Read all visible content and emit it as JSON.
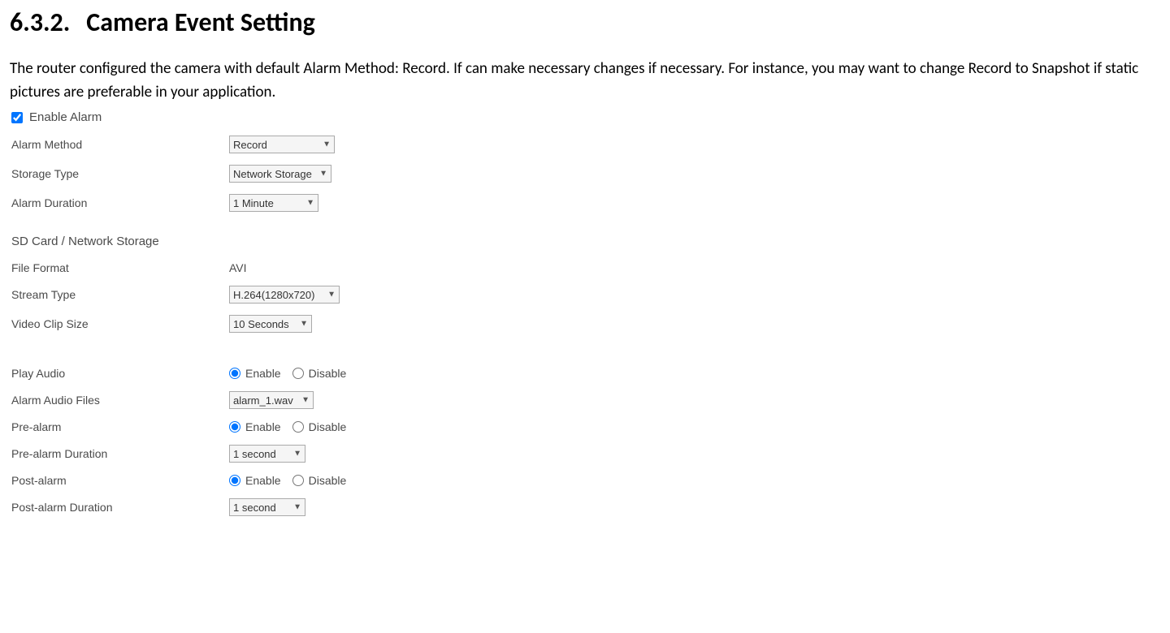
{
  "heading": {
    "number": "6.3.2.",
    "title": "Camera Event Setting"
  },
  "intro": "The router configured the camera with default Alarm Method: Record. If can make necessary changes if necessary. For instance, you may want to change Record to Snapshot if static pictures are preferable in your application.",
  "enable_alarm": {
    "label": "Enable Alarm",
    "checked": true
  },
  "fields": {
    "alarm_method": {
      "label": "Alarm Method",
      "value": "Record"
    },
    "storage_type": {
      "label": "Storage Type",
      "value": "Network Storage"
    },
    "alarm_duration": {
      "label": "Alarm Duration",
      "value": "1 Minute"
    }
  },
  "storage_section": {
    "heading": "SD Card / Network Storage",
    "file_format": {
      "label": "File Format",
      "value": "AVI"
    },
    "stream_type": {
      "label": "Stream Type",
      "value": "H.264(1280x720)"
    },
    "video_clip_size": {
      "label": "Video Clip Size",
      "value": "10 Seconds"
    }
  },
  "audio_section": {
    "play_audio": {
      "label": "Play Audio",
      "enable": "Enable",
      "disable": "Disable",
      "selected": "enable"
    },
    "alarm_audio_files": {
      "label": "Alarm Audio Files",
      "value": "alarm_1.wav"
    },
    "pre_alarm": {
      "label": "Pre-alarm",
      "enable": "Enable",
      "disable": "Disable",
      "selected": "enable"
    },
    "pre_alarm_duration": {
      "label": "Pre-alarm Duration",
      "value": "1 second"
    },
    "post_alarm": {
      "label": "Post-alarm",
      "enable": "Enable",
      "disable": "Disable",
      "selected": "enable"
    },
    "post_alarm_duration": {
      "label": "Post-alarm Duration",
      "value": "1 second"
    }
  }
}
